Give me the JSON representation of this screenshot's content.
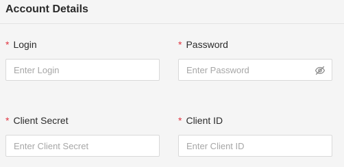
{
  "section": {
    "title": "Account Details"
  },
  "fields": {
    "login": {
      "required_mark": "*",
      "label": "Login",
      "value": "",
      "placeholder": "Enter Login"
    },
    "password": {
      "required_mark": "*",
      "label": "Password",
      "value": "",
      "placeholder": "Enter Password",
      "toggle_icon": "eye-slash-icon"
    },
    "client_secret": {
      "required_mark": "*",
      "label": "Client Secret",
      "value": "",
      "placeholder": "Enter Client Secret"
    },
    "client_id": {
      "required_mark": "*",
      "label": "Client ID",
      "value": "",
      "placeholder": "Enter Client ID"
    }
  },
  "colors": {
    "required": "#e0323f",
    "border": "#d9d9d9",
    "placeholder": "#a6a6a6",
    "text": "#2a2a2a"
  }
}
